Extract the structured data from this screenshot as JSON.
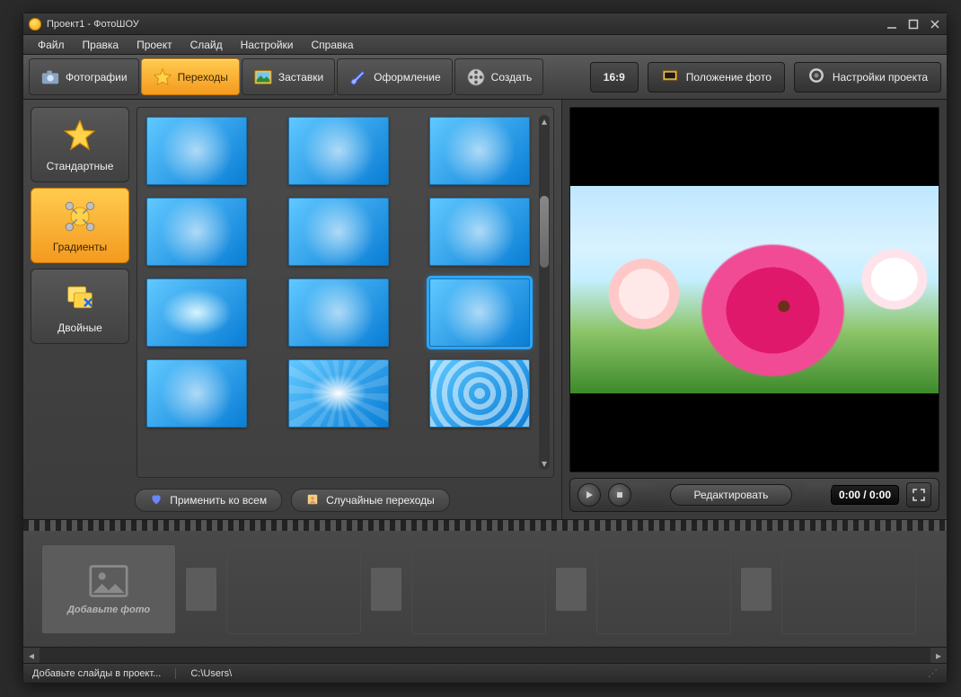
{
  "title": "Проект1 - ФотоШОУ",
  "menu": [
    "Файл",
    "Правка",
    "Проект",
    "Слайд",
    "Настройки",
    "Справка"
  ],
  "tabs": {
    "photos": "Фотографии",
    "transitions": "Переходы",
    "covers": "Заставки",
    "design": "Оформление",
    "create": "Создать"
  },
  "tools": {
    "aspect": "16:9",
    "position": "Положение фото",
    "settings": "Настройки проекта"
  },
  "categories": {
    "standard": "Стандартные",
    "gradients": "Градиенты",
    "double": "Двойные"
  },
  "left_buttons": {
    "apply_all": "Применить ко всем",
    "random": "Случайные переходы"
  },
  "player": {
    "edit": "Редактировать",
    "time": "0:00 / 0:00"
  },
  "timeline": {
    "add_photo": "Добавьте фото"
  },
  "status": {
    "hint": "Добавьте слайды в проект...",
    "path": "C:\\Users\\"
  },
  "colors": {
    "accent": "#f49a1f",
    "blue": "#2aa7ff"
  },
  "gallery_selected": 8
}
